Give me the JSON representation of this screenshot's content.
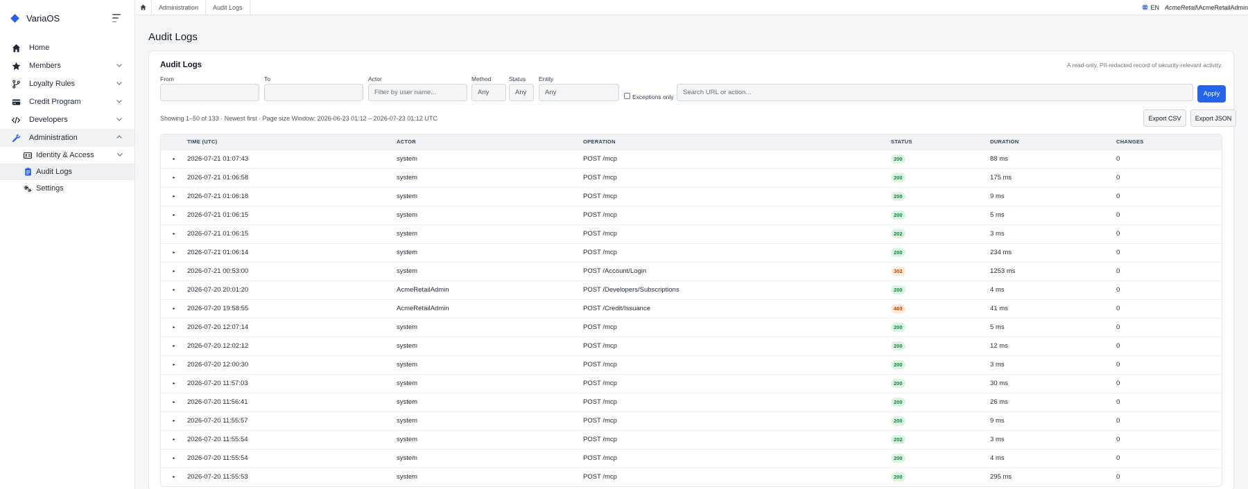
{
  "brand": {
    "name": "VariaOS",
    "accent": "#2563eb"
  },
  "sidebar": {
    "items": [
      {
        "label": "Home",
        "icon": "home-icon"
      },
      {
        "label": "Members",
        "icon": "star-icon"
      },
      {
        "label": "Loyalty Rules",
        "icon": "branch-icon"
      },
      {
        "label": "Credit Program",
        "icon": "credit-card-icon"
      },
      {
        "label": "Developers",
        "icon": "code-icon"
      },
      {
        "label": "Administration",
        "icon": "wrench-icon"
      }
    ],
    "sub_items": [
      {
        "label": "Identity & Access",
        "icon": "id-card-icon"
      },
      {
        "label": "Audit Logs",
        "icon": "clipboard-icon"
      },
      {
        "label": "Settings",
        "icon": "gears-icon"
      }
    ]
  },
  "topbar": {
    "breadcrumb": [
      "Administration",
      "Audit Logs"
    ],
    "language": "EN",
    "user_tenant": "AcmeRetail",
    "user_name": "\\AcmeRetailAdmin"
  },
  "page": {
    "title": "Audit Logs",
    "card_title": "Audit Logs",
    "card_subtitle": "A read-only, PII-redacted record of security-relevant activity."
  },
  "filters": {
    "from_label": "From",
    "from_value": "",
    "to_label": "To",
    "to_value": "",
    "actor_label": "Actor",
    "actor_placeholder": "Filter by user name...",
    "method_label": "Method",
    "method_value": "Any",
    "status_label": "Status",
    "status_value": "Any",
    "entity_label": "Entity",
    "entity_value": "Any",
    "exceptions_label": "Exceptions only",
    "search_placeholder": "Search URL or action...",
    "apply_label": "Apply"
  },
  "results": {
    "summary": "Showing 1–50 of 133 · Newest first · Page size   Window: 2026-06-23 01:12 – 2026-07-23 01:12 UTC",
    "export_csv": "Export CSV",
    "export_json": "Export JSON"
  },
  "table": {
    "columns": [
      "TIME (UTC)",
      "ACTOR",
      "OPERATION",
      "STATUS",
      "DURATION",
      "CHANGES"
    ],
    "rows": [
      {
        "time": "2026-07-21 01:07:43",
        "actor": "system",
        "operation": "POST /mcp",
        "status": "200",
        "duration": "88 ms",
        "changes": "0"
      },
      {
        "time": "2026-07-21 01:06:58",
        "actor": "system",
        "operation": "POST /mcp",
        "status": "200",
        "duration": "175 ms",
        "changes": "0"
      },
      {
        "time": "2026-07-21 01:06:18",
        "actor": "system",
        "operation": "POST /mcp",
        "status": "200",
        "duration": "9 ms",
        "changes": "0"
      },
      {
        "time": "2026-07-21 01:06:15",
        "actor": "system",
        "operation": "POST /mcp",
        "status": "200",
        "duration": "5 ms",
        "changes": "0"
      },
      {
        "time": "2026-07-21 01:06:15",
        "actor": "system",
        "operation": "POST /mcp",
        "status": "202",
        "duration": "3 ms",
        "changes": "0"
      },
      {
        "time": "2026-07-21 01:06:14",
        "actor": "system",
        "operation": "POST /mcp",
        "status": "200",
        "duration": "234 ms",
        "changes": "0"
      },
      {
        "time": "2026-07-21 00:53:00",
        "actor": "system",
        "operation": "POST /Account/Login",
        "status": "302",
        "duration": "1253 ms",
        "changes": "0"
      },
      {
        "time": "2026-07-20 20:01:20",
        "actor": "AcmeRetailAdmin",
        "operation": "POST /Developers/Subscriptions",
        "status": "200",
        "duration": "4 ms",
        "changes": "0"
      },
      {
        "time": "2026-07-20 19:58:55",
        "actor": "AcmeRetailAdmin",
        "operation": "POST /Credit/Issuance",
        "status": "403",
        "duration": "41 ms",
        "changes": "0"
      },
      {
        "time": "2026-07-20 12:07:14",
        "actor": "system",
        "operation": "POST /mcp",
        "status": "200",
        "duration": "5 ms",
        "changes": "0"
      },
      {
        "time": "2026-07-20 12:02:12",
        "actor": "system",
        "operation": "POST /mcp",
        "status": "200",
        "duration": "12 ms",
        "changes": "0"
      },
      {
        "time": "2026-07-20 12:00:30",
        "actor": "system",
        "operation": "POST /mcp",
        "status": "200",
        "duration": "3 ms",
        "changes": "0"
      },
      {
        "time": "2026-07-20 11:57:03",
        "actor": "system",
        "operation": "POST /mcp",
        "status": "200",
        "duration": "30 ms",
        "changes": "0"
      },
      {
        "time": "2026-07-20 11:56:41",
        "actor": "system",
        "operation": "POST /mcp",
        "status": "200",
        "duration": "26 ms",
        "changes": "0"
      },
      {
        "time": "2026-07-20 11:55:57",
        "actor": "system",
        "operation": "POST /mcp",
        "status": "200",
        "duration": "9 ms",
        "changes": "0"
      },
      {
        "time": "2026-07-20 11:55:54",
        "actor": "system",
        "operation": "POST /mcp",
        "status": "202",
        "duration": "3 ms",
        "changes": "0"
      },
      {
        "time": "2026-07-20 11:55:54",
        "actor": "system",
        "operation": "POST /mcp",
        "status": "200",
        "duration": "4 ms",
        "changes": "0"
      },
      {
        "time": "2026-07-20 11:55:53",
        "actor": "system",
        "operation": "POST /mcp",
        "status": "200",
        "duration": "295 ms",
        "changes": "0"
      }
    ]
  }
}
